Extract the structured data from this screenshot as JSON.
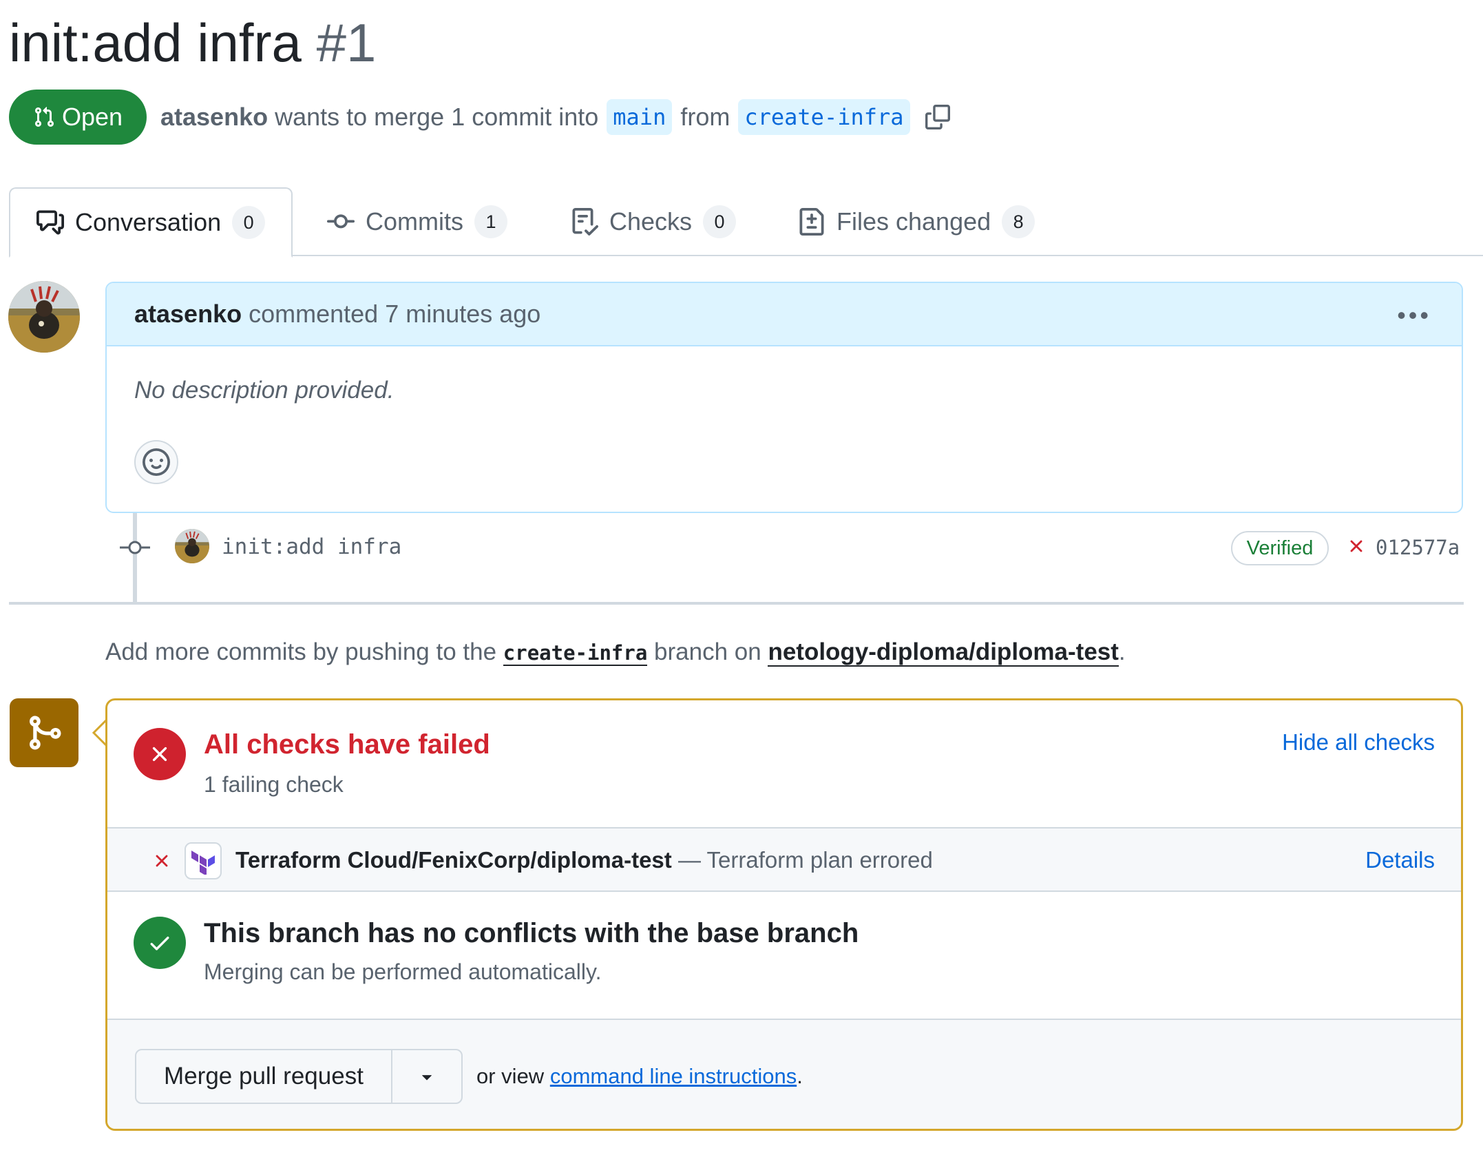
{
  "pr": {
    "title": "init:add infra",
    "number": "#1",
    "state": "Open",
    "author": "atasenko",
    "merge_text_1": "wants to merge 1 commit into",
    "base_branch": "main",
    "merge_text_2": "from",
    "head_branch": "create-infra"
  },
  "tabs": [
    {
      "label": "Conversation",
      "count": "0",
      "icon": "comment-discussion-icon"
    },
    {
      "label": "Commits",
      "count": "1",
      "icon": "git-commit-icon"
    },
    {
      "label": "Checks",
      "count": "0",
      "icon": "checklist-icon"
    },
    {
      "label": "Files changed",
      "count": "8",
      "icon": "file-diff-icon"
    }
  ],
  "comment": {
    "author": "atasenko",
    "action": "commented",
    "time": "7 minutes ago",
    "body": "No description provided."
  },
  "commit": {
    "message": "init:add infra",
    "verified": "Verified",
    "sha": "012577a"
  },
  "add_more": {
    "prefix": "Add more commits by pushing to the",
    "branch": "create-infra",
    "middle": "branch on",
    "repo": "netology-diploma/diploma-test",
    "suffix": "."
  },
  "checks": {
    "title": "All checks have failed",
    "subtitle": "1 failing check",
    "hide_label": "Hide all checks",
    "items": [
      {
        "name": "Terraform Cloud/FenixCorp/diploma-test",
        "separator": "—",
        "description": "Terraform plan errored",
        "details_label": "Details"
      }
    ]
  },
  "conflicts": {
    "title": "This branch has no conflicts with the base branch",
    "subtitle": "Merging can be performed automatically."
  },
  "merge": {
    "button_label": "Merge pull request",
    "or_view": "or view",
    "cli_link": "command line instructions",
    "cli_suffix": "."
  },
  "colors": {
    "open_green": "#1f883d",
    "fail_red": "#cf222e",
    "link_blue": "#0969da",
    "merge_box_border": "#d4a72c",
    "merge_icon_bg": "#9a6700"
  }
}
